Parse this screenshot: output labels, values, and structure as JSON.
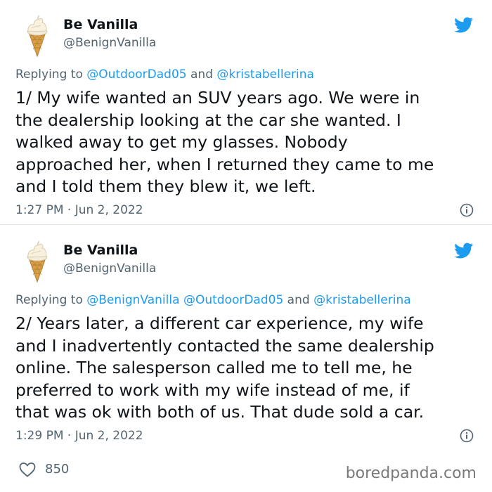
{
  "tweets": [
    {
      "display_name": "Be Vanilla",
      "handle": "@BenignVanilla",
      "reply_prefix": "Replying to ",
      "reply_mentions": [
        "@OutdoorDad05",
        "@kristabellerina"
      ],
      "reply_joiners": [
        " and "
      ],
      "lines": [
        "1/ My wife wanted an SUV years ago. We were in",
        "the dealership looking at the car she wanted. I",
        "walked away to get my glasses. Nobody",
        "approached her, when I returned they came to me",
        "and I told them they blew it, we left."
      ],
      "timestamp": "1:27 PM · Jun 2, 2022"
    },
    {
      "display_name": "Be Vanilla",
      "handle": "@BenignVanilla",
      "reply_prefix": "Replying to ",
      "reply_mentions": [
        "@BenignVanilla",
        "@OutdoorDad05",
        "@kristabellerina"
      ],
      "reply_joiners": [
        " ",
        " and "
      ],
      "lines": [
        "2/ Years later, a different car experience, my wife",
        "and I inadvertently contacted the same dealership",
        "online. The salesperson called me to tell me, he",
        "preferred to work with my wife instead of me, if",
        "that was ok with both of us. That dude sold a car."
      ],
      "timestamp": "1:29 PM · Jun 2, 2022"
    }
  ],
  "footer": {
    "like_count": "850",
    "watermark": "boredpanda.com"
  },
  "icons": {
    "twitter": "twitter-bird-icon",
    "avatar": "ice-cream-cone-avatar",
    "info": "info-icon",
    "like": "heart-icon"
  },
  "colors": {
    "mention": "#1d9bf0",
    "secondary_text": "#536471",
    "twitter_blue": "#1d9bf0"
  }
}
